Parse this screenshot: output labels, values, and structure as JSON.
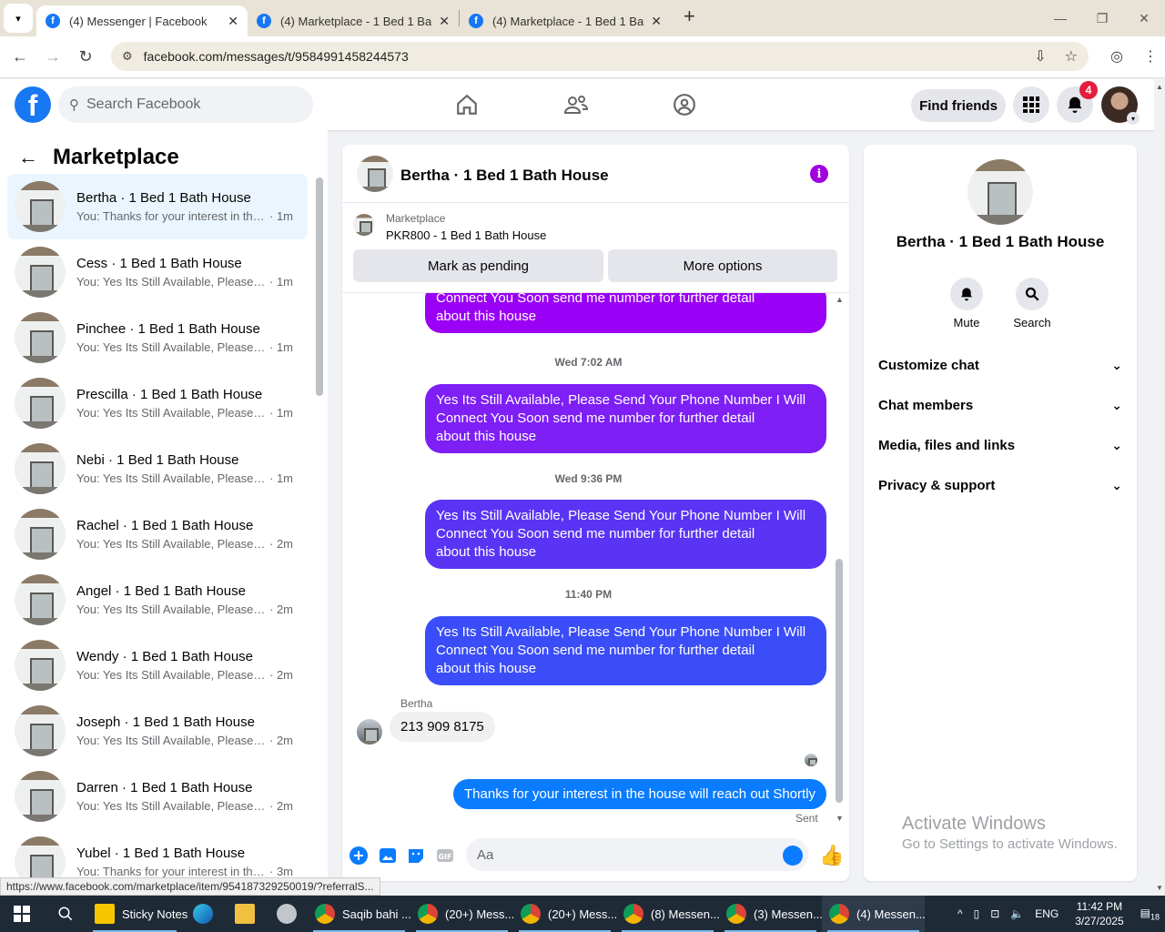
{
  "browser": {
    "tabs": [
      {
        "title": "(4) Messenger | Facebook",
        "active": true
      },
      {
        "title": "(4) Marketplace - 1 Bed 1 Bath H",
        "active": false
      },
      {
        "title": "(4) Marketplace - 1 Bed 1 Bath H",
        "active": false
      }
    ],
    "url": "facebook.com/messages/t/9584991458244573",
    "status_url": "https://www.facebook.com/marketplace/item/954187329250019/?referralS..."
  },
  "fb": {
    "search_placeholder": "Search Facebook",
    "find_friends": "Find friends",
    "notification_count": "4"
  },
  "left": {
    "title": "Marketplace",
    "conversations": [
      {
        "name": "Bertha · 1 Bed 1 Bath House",
        "preview": "You: Thanks for your interest in the...",
        "time": "· 1m",
        "selected": true
      },
      {
        "name": "Cess · 1 Bed 1 Bath House",
        "preview": "You: Yes Its Still Available, Please S...",
        "time": "· 1m"
      },
      {
        "name": "Pinchee · 1 Bed 1 Bath House",
        "preview": "You: Yes Its Still Available, Please S...",
        "time": "· 1m"
      },
      {
        "name": "Prescilla · 1 Bed 1 Bath House",
        "preview": "You: Yes Its Still Available, Please S...",
        "time": "· 1m"
      },
      {
        "name": "Nebi · 1 Bed 1 Bath House",
        "preview": "You: Yes Its Still Available, Please S...",
        "time": "· 1m"
      },
      {
        "name": "Rachel · 1 Bed 1 Bath House",
        "preview": "You: Yes Its Still Available, Please S...",
        "time": "· 2m"
      },
      {
        "name": "Angel · 1 Bed 1 Bath House",
        "preview": "You: Yes Its Still Available, Please S...",
        "time": "· 2m"
      },
      {
        "name": "Wendy · 1 Bed 1 Bath House",
        "preview": "You: Yes Its Still Available, Please S...",
        "time": "· 2m"
      },
      {
        "name": "Joseph · 1 Bed 1 Bath House",
        "preview": "You: Yes Its Still Available, Please S...",
        "time": "· 2m"
      },
      {
        "name": "Darren · 1 Bed 1 Bath House",
        "preview": "You: Yes Its Still Available, Please S...",
        "time": "· 2m"
      },
      {
        "name": "Yubel · 1 Bed 1 Bath House",
        "preview": "You: Thanks for your interest in the...",
        "time": "· 3m"
      }
    ]
  },
  "chat": {
    "title": "Bertha · 1 Bed 1 Bath House",
    "marketplace_label": "Marketplace",
    "listing": "PKR800 - 1 Bed 1 Bath House",
    "mark_pending": "Mark as pending",
    "more_options": "More options",
    "partial_bubble": {
      "line1": "Connect You Soon        send me number for further detail",
      "line2": "about this house"
    },
    "groups": [
      {
        "time": "Wed 7:02 AM",
        "line1": "Yes Its Still Available, Please Send Your Phone Number I Will",
        "line2": "Connect You Soon        send me number for further detail",
        "line3": "about this house",
        "color": "#7d1ff5"
      },
      {
        "time": "Wed 9:36 PM",
        "line1": "Yes Its Still Available, Please Send Your Phone Number I Will",
        "line2": "Connect You Soon        send me number for further detail",
        "line3": "about this house",
        "color": "#5a34f5"
      },
      {
        "time": "11:40 PM",
        "line1": "Yes Its Still Available, Please Send Your Phone Number I Will",
        "line2": "Connect You Soon        send me number for further detail",
        "line3": "about this house",
        "color": "#3a4df8"
      }
    ],
    "incoming_sender": "Bertha",
    "incoming_text": "213 909 8175",
    "outgoing_text": "Thanks for your interest in the house will reach out Shortly",
    "sent_label": "Sent",
    "composer_placeholder": "Aa"
  },
  "right": {
    "name": "Bertha · 1 Bed 1 Bath House",
    "mute": "Mute",
    "search": "Search",
    "sections": [
      "Customize chat",
      "Chat members",
      "Media, files and links",
      "Privacy & support"
    ]
  },
  "watermark": {
    "line1": "Activate Windows",
    "line2": "Go to Settings to activate Windows."
  },
  "taskbar": {
    "items": [
      "Sticky Notes",
      "Saqib bahi ...",
      "(20+) Mess...",
      "(20+) Mess...",
      "(8) Messen...",
      "(3) Messen...",
      "(4) Messen..."
    ],
    "lang": "ENG",
    "time": "11:42 PM",
    "date": "3/27/2025",
    "notif": "18"
  },
  "colors": {
    "fb_blue": "#1877f2",
    "messenger_blue": "#0a7cff",
    "purple": "#a000e0"
  }
}
